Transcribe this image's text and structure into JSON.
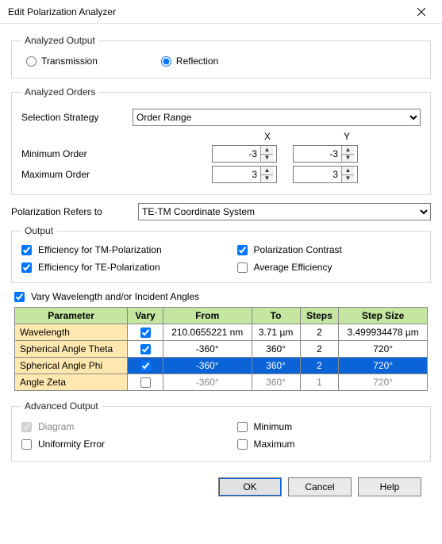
{
  "window": {
    "title": "Edit Polarization Analyzer"
  },
  "analyzed_output": {
    "legend": "Analyzed Output",
    "transmission_label": "Transmission",
    "reflection_label": "Reflection",
    "selected": "reflection"
  },
  "analyzed_orders": {
    "legend": "Analyzed Orders",
    "strategy_label": "Selection Strategy",
    "strategy_value": "Order Range",
    "x_header": "X",
    "y_header": "Y",
    "min_label": "Minimum Order",
    "max_label": "Maximum Order",
    "min_x": "-3",
    "min_y": "-3",
    "max_x": "3",
    "max_y": "3"
  },
  "polarization_refers": {
    "label": "Polarization Refers to",
    "value": "TE-TM Coordinate System"
  },
  "output": {
    "legend": "Output",
    "eff_tm": "Efficiency for TM-Polarization",
    "eff_te": "Efficiency for TE-Polarization",
    "contrast": "Polarization Contrast",
    "avg_eff": "Average Efficiency"
  },
  "vary_section": {
    "label": "Vary Wavelength and/or Incident Angles",
    "headers": {
      "param": "Parameter",
      "vary": "Vary",
      "from": "From",
      "to": "To",
      "steps": "Steps",
      "step_size": "Step Size"
    },
    "rows": [
      {
        "param": "Wavelength",
        "vary": true,
        "from": "210.0655221 nm",
        "to": "3.71 µm",
        "steps": "2",
        "step": "3.499934478 µm",
        "selected": false,
        "disabled": false
      },
      {
        "param": "Spherical Angle Theta",
        "vary": true,
        "from": "-360°",
        "to": "360°",
        "steps": "2",
        "step": "720°",
        "selected": false,
        "disabled": false
      },
      {
        "param": "Spherical Angle Phi",
        "vary": true,
        "from": "-360°",
        "to": "360°",
        "steps": "2",
        "step": "720°",
        "selected": true,
        "disabled": false
      },
      {
        "param": "Angle Zeta",
        "vary": false,
        "from": "-360°",
        "to": "360°",
        "steps": "1",
        "step": "720°",
        "selected": false,
        "disabled": true
      }
    ]
  },
  "advanced": {
    "legend": "Advanced Output",
    "diagram": "Diagram",
    "uniformity": "Uniformity Error",
    "minimum": "Minimum",
    "maximum": "Maximum"
  },
  "buttons": {
    "ok": "OK",
    "cancel": "Cancel",
    "help": "Help"
  }
}
